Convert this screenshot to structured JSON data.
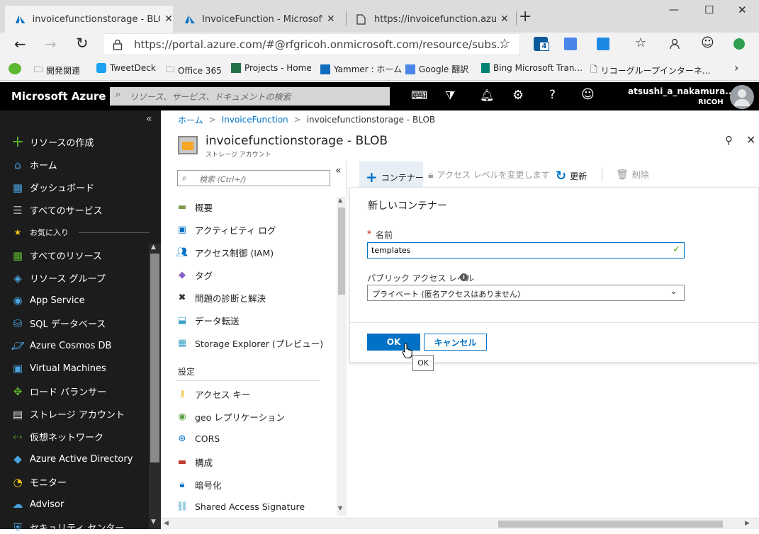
{
  "browser": {
    "tabs": [
      {
        "title": "invoicefunctionstorage - BLOB - ",
        "close": "✕"
      },
      {
        "title": "InvoiceFunction - Microsoft Azur",
        "close": "✕"
      },
      {
        "title": "https://invoicefunction.azureweb",
        "close": "✕"
      }
    ],
    "new_tab": "+",
    "window_controls": {
      "minimize": "—",
      "maximize": "☐",
      "close": "✕"
    },
    "url": "https://portal.azure.com/#@rfgricoh.onmicrosoft.com/resource/subs...",
    "extension_badge": "4",
    "favorites": [
      "開発関連",
      "TweetDeck",
      "Office 365",
      "Projects - Home",
      "Yammer : ホーム",
      "Google 翻訳",
      "Bing Microsoft Tran...",
      "リコーグループインターネ..."
    ]
  },
  "azure_header": {
    "brand": "Microsoft Azure",
    "search_placeholder": "リソース、サービス、ドキュメントの検索",
    "user_name": "atsushi_a_nakamura...",
    "user_org": "RICOH"
  },
  "left_nav": {
    "collapse": "«",
    "create": "リソースの作成",
    "items": [
      "ホーム",
      "ダッシュボード",
      "すべてのサービス"
    ],
    "favorites_label": "お気に入り",
    "favorites": [
      "すべてのリソース",
      "リソース グループ",
      "App Service",
      "SQL データベース",
      "Azure Cosmos DB",
      "Virtual Machines",
      "ロード バランサー",
      "ストレージ アカウント",
      "仮想ネットワーク",
      "Azure Active Directory",
      "モニター",
      "Advisor",
      "セキュリティ センター"
    ]
  },
  "breadcrumb": {
    "home": "ホーム",
    "sep": ">",
    "function": "InvoiceFunction",
    "current": "invoicefunctionstorage - BLOB"
  },
  "blade": {
    "title": "invoicefunctionstorage - BLOB",
    "subtitle": "ストレージ アカウント"
  },
  "resource_menu": {
    "search_placeholder": "検索 (Ctrl+/)",
    "collapse": "«",
    "items": [
      "概要",
      "アクティビティ ログ",
      "アクセス制御 (IAM)",
      "タグ",
      "問題の診断と解決",
      "データ転送",
      "Storage Explorer (プレビュー)"
    ],
    "section_settings": "設定",
    "settings": [
      "アクセス キー",
      "geo レプリケーション",
      "CORS",
      "構成",
      "暗号化",
      "Shared Access Signature"
    ]
  },
  "toolbar": {
    "container": "コンテナー",
    "change_access": "アクセス レベルを変更します",
    "refresh": "更新",
    "delete": "削除"
  },
  "new_container": {
    "title": "新しいコンテナー",
    "required_mark": "*",
    "name_label": "名前",
    "name_value": "templates",
    "public_access_label": "パブリック アクセス レベル",
    "public_access_value": "プライベート (匿名アクセスはありません)",
    "ok": "OK",
    "cancel": "キャンセル",
    "tooltip": "OK"
  },
  "colors": {
    "accent": "#0072c6",
    "nav_bg": "#1c1c1c",
    "header_bg": "#000000"
  }
}
